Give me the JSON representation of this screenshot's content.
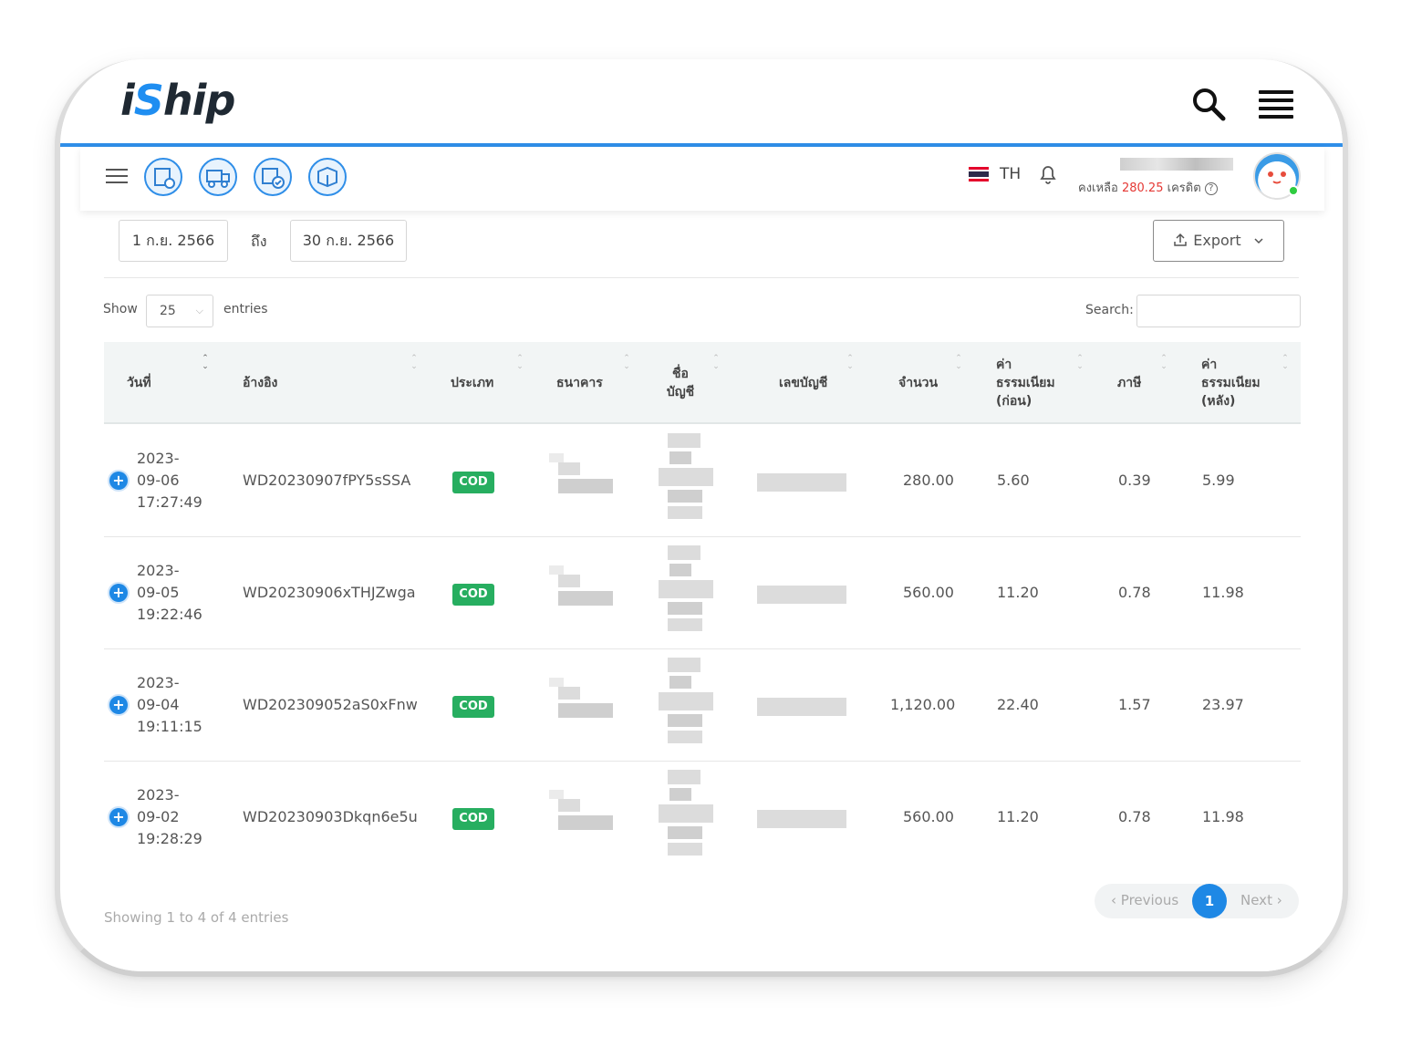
{
  "brand": {
    "logo_text_a": "i",
    "logo_text_b": "S",
    "logo_text_c": "hip"
  },
  "header": {
    "language": "TH",
    "credit_prefix": "คงเหลือ",
    "credit_amount": "280.25",
    "credit_suffix": "เครดิต"
  },
  "filters": {
    "date_from": "1 ก.ย. 2566",
    "separator": "ถึง",
    "date_to": "30 ก.ย. 2566",
    "export_label": "Export"
  },
  "table_controls": {
    "show_label": "Show",
    "page_size": "25",
    "entries_label": "entries",
    "search_label": "Search:"
  },
  "table": {
    "columns": [
      {
        "label": "วันที่"
      },
      {
        "label": "อ้างอิง"
      },
      {
        "label": "ประเภท"
      },
      {
        "label": "ธนาคาร"
      },
      {
        "label": "ชื่อ บัญชี"
      },
      {
        "label": "เลขบัญชี"
      },
      {
        "label": "จำนวน"
      },
      {
        "label": "ค่า ธรรมเนียม (ก่อน)"
      },
      {
        "label": "ภาษี"
      },
      {
        "label": "ค่า ธรรมเนียม (หลัง)"
      }
    ],
    "rows": [
      {
        "date_a": "2023-",
        "date_b": "09-06",
        "date_c": "17:27:49",
        "ref": "WD20230907fPY5sSSA",
        "type": "COD",
        "amount": "280.00",
        "fee_before": "5.60",
        "tax": "0.39",
        "fee_after": "5.99"
      },
      {
        "date_a": "2023-",
        "date_b": "09-05",
        "date_c": "19:22:46",
        "ref": "WD20230906xTHJZwga",
        "type": "COD",
        "amount": "560.00",
        "fee_before": "11.20",
        "tax": "0.78",
        "fee_after": "11.98"
      },
      {
        "date_a": "2023-",
        "date_b": "09-04",
        "date_c": "19:11:15",
        "ref": "WD202309052aS0xFnw",
        "type": "COD",
        "amount": "1,120.00",
        "fee_before": "22.40",
        "tax": "1.57",
        "fee_after": "23.97"
      },
      {
        "date_a": "2023-",
        "date_b": "09-02",
        "date_c": "19:28:29",
        "ref": "WD20230903Dkqn6e5u",
        "type": "COD",
        "amount": "560.00",
        "fee_before": "11.20",
        "tax": "0.78",
        "fee_after": "11.98"
      }
    ]
  },
  "footer": {
    "info": "Showing 1 to 4 of 4 entries",
    "prev": "Previous",
    "current_page": "1",
    "next": "Next"
  },
  "colors": {
    "accent": "#1e88e5",
    "cod": "#27ae60",
    "credit": "#e53935"
  }
}
